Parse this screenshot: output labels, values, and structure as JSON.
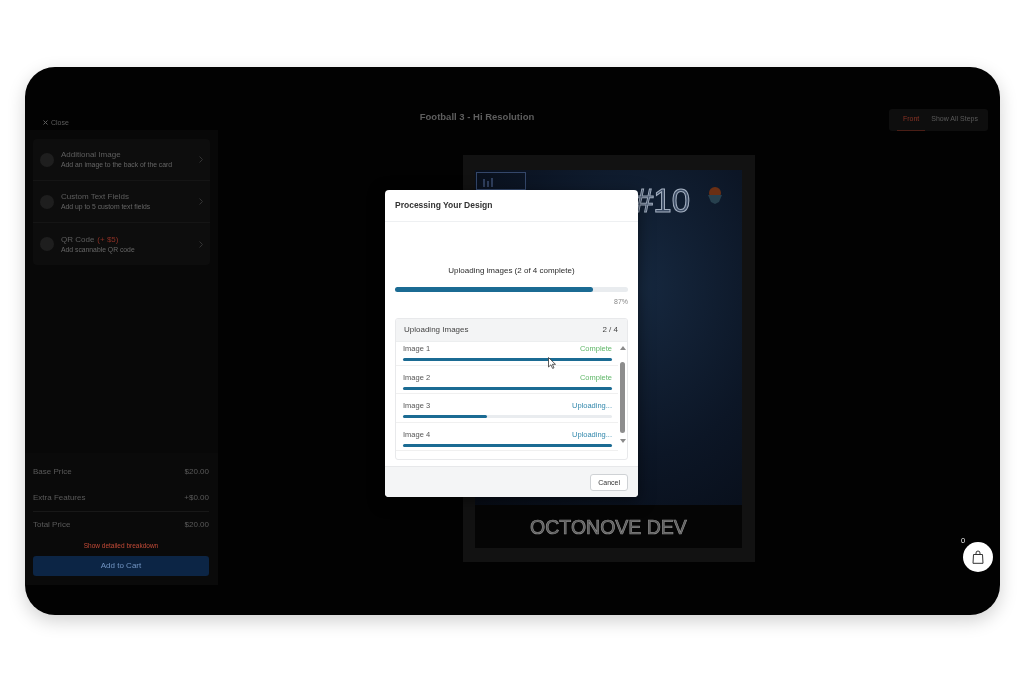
{
  "header": {
    "close_label": "Close",
    "title": "Football 3 - Hi Resolution",
    "tabs": [
      {
        "label": "Front",
        "selected": true
      },
      {
        "label": "Show All Steps",
        "selected": false
      }
    ]
  },
  "sidebar": {
    "options": [
      {
        "title": "Additional Image",
        "description": "Add an image to the back of the card"
      },
      {
        "title": "Custom Text Fields",
        "description": "Add up to 5 custom text fields"
      },
      {
        "title": "QR Code",
        "price": "(+ $5)",
        "description": "Add scannable QR code"
      }
    ]
  },
  "pricing": {
    "rows": [
      {
        "label": "Base Price",
        "value": "$20.00"
      },
      {
        "label": "Extra Features",
        "value": "+$0.00"
      },
      {
        "label": "Total Price",
        "value": "$20.00"
      }
    ],
    "breakdown_link": "Show detailed breakdown",
    "add_to_cart": "Add to Cart"
  },
  "card_preview": {
    "number": "#10",
    "name": "OCTONOVE DEV"
  },
  "cart": {
    "count": "0"
  },
  "modal": {
    "title": "Processing Your Design",
    "status": "Uploading images (2 of 4 complete)",
    "progress": {
      "level": 0.85,
      "reading": "87%"
    },
    "uploads": {
      "title": "Uploading Images",
      "count": "2 / 4",
      "items": [
        {
          "name": "Image 1",
          "status": "Complete",
          "kind": "complete",
          "level": 1
        },
        {
          "name": "Image 2",
          "status": "Complete",
          "kind": "complete",
          "level": 1
        },
        {
          "name": "Image 3",
          "status": "Uploading...",
          "kind": "uploading",
          "level": 0.4
        },
        {
          "name": "Image 4",
          "status": "Uploading...",
          "kind": "uploading",
          "level": 1
        }
      ]
    },
    "cancel": "Cancel"
  }
}
